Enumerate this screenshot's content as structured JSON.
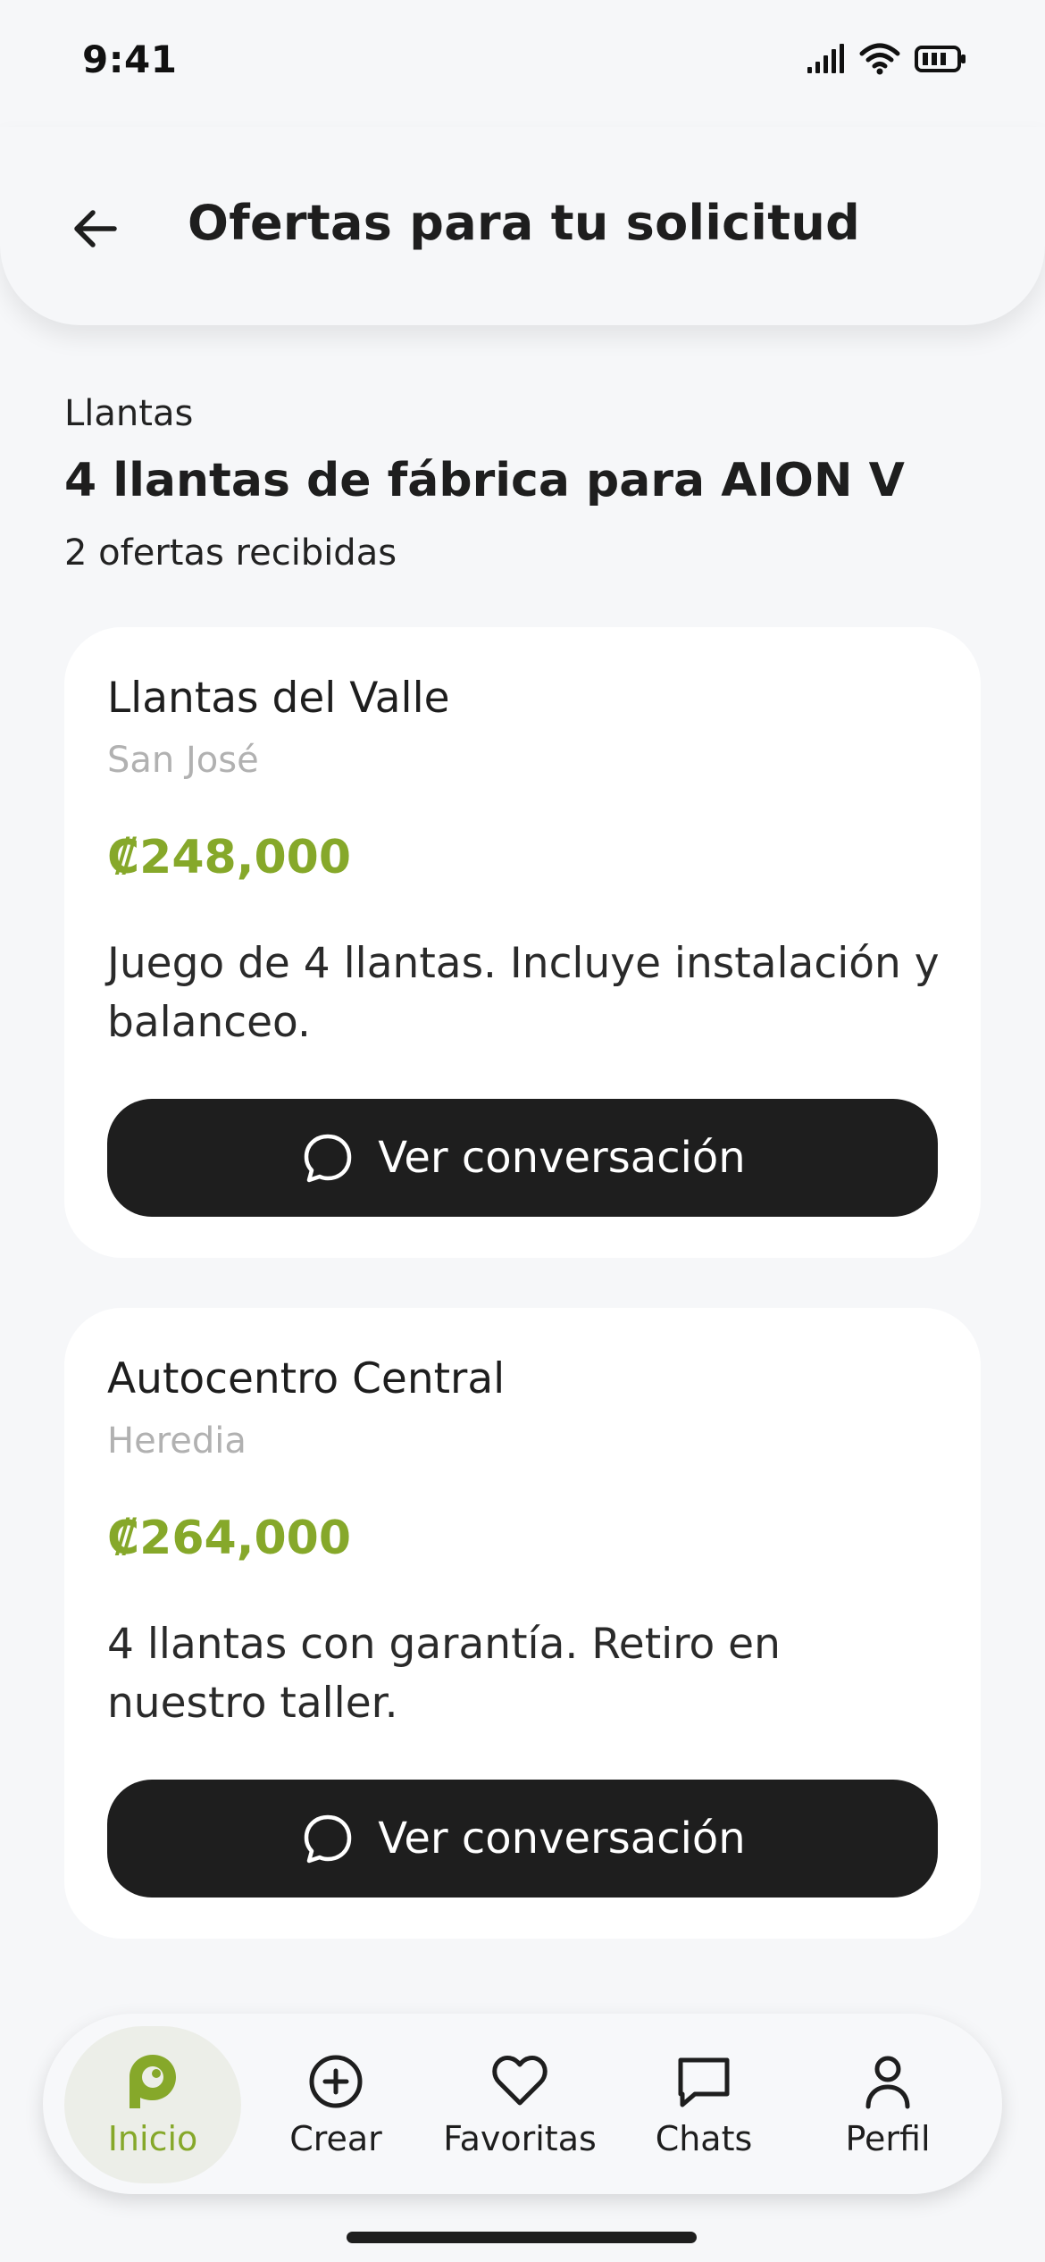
{
  "status": {
    "time": "9:41"
  },
  "header": {
    "title": "Ofertas para tu solicitud"
  },
  "request": {
    "category": "Llantas",
    "title": "4 llantas de fábrica para AION V",
    "offers_count": "2 ofertas recibidas"
  },
  "offers": [
    {
      "store": "Llantas del Valle",
      "location": "San José",
      "price": "₡248,000",
      "description": "Juego de 4 llantas. Incluye instalación y balanceo.",
      "button_label": "Ver conversación"
    },
    {
      "store": "Autocentro Central",
      "location": "Heredia",
      "price": "₡264,000",
      "description": "4 llantas con garantía. Retiro en nuestro taller.",
      "button_label": "Ver conversación"
    }
  ],
  "nav": {
    "items": [
      {
        "label": "Inicio",
        "icon": "home-logo-icon",
        "active": true
      },
      {
        "label": "Crear",
        "icon": "plus-circle-icon"
      },
      {
        "label": "Favoritas",
        "icon": "heart-icon"
      },
      {
        "label": "Chats",
        "icon": "chat-icon"
      },
      {
        "label": "Perfil",
        "icon": "user-icon"
      }
    ]
  },
  "colors": {
    "accent": "#86a82a",
    "button": "#1e1e1e",
    "background": "#f6f7f9"
  }
}
